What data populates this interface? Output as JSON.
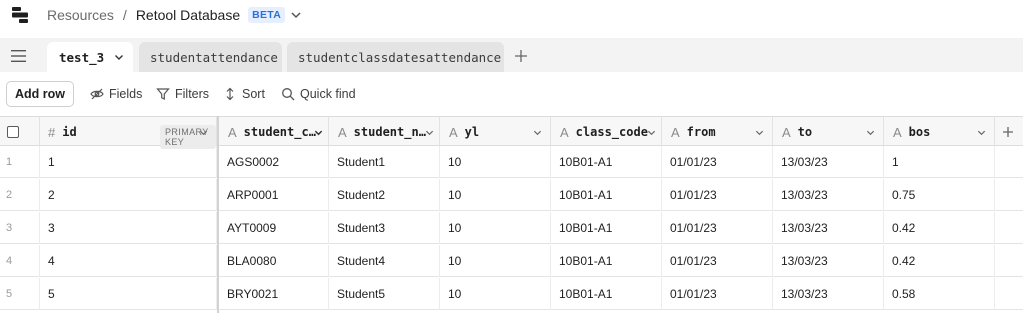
{
  "breadcrumb": {
    "parent": "Resources",
    "separator": "/",
    "current": "Retool Database",
    "badge": "BETA"
  },
  "tabs": [
    {
      "label": "test_3",
      "active": true
    },
    {
      "label": "studentattendance",
      "active": false
    },
    {
      "label": "studentclassdatesattendance",
      "active": false
    }
  ],
  "toolbar": {
    "add_row": "Add row",
    "fields": "Fields",
    "filters": "Filters",
    "sort": "Sort",
    "quick_find": "Quick find"
  },
  "columns": [
    {
      "type_icon": "#",
      "label": "id",
      "badge": "PRIMARY KEY"
    },
    {
      "type_icon": "A",
      "label": "student_c…"
    },
    {
      "type_icon": "A",
      "label": "student_n…"
    },
    {
      "type_icon": "A",
      "label": "yl"
    },
    {
      "type_icon": "A",
      "label": "class_code"
    },
    {
      "type_icon": "A",
      "label": "from"
    },
    {
      "type_icon": "A",
      "label": "to"
    },
    {
      "type_icon": "A",
      "label": "bos"
    }
  ],
  "rows": [
    {
      "num": "1",
      "cells": [
        "1",
        "AGS0002",
        "Student1",
        "10",
        "10B01-A1",
        "01/01/23",
        "13/03/23",
        "1"
      ]
    },
    {
      "num": "2",
      "cells": [
        "2",
        "ARP0001",
        "Student2",
        "10",
        "10B01-A1",
        "01/01/23",
        "13/03/23",
        "0.75"
      ]
    },
    {
      "num": "3",
      "cells": [
        "3",
        "AYT0009",
        "Student3",
        "10",
        "10B01-A1",
        "01/01/23",
        "13/03/23",
        "0.42"
      ]
    },
    {
      "num": "4",
      "cells": [
        "4",
        "BLA0080",
        "Student4",
        "10",
        "10B01-A1",
        "01/01/23",
        "13/03/23",
        "0.42"
      ]
    },
    {
      "num": "5",
      "cells": [
        "5",
        "BRY0021",
        "Student5",
        "10",
        "10B01-A1",
        "01/01/23",
        "13/03/23",
        "0.58"
      ]
    }
  ],
  "colors": {
    "accent": "#2a6fdb",
    "tab_bg": "#f3f3f3"
  }
}
